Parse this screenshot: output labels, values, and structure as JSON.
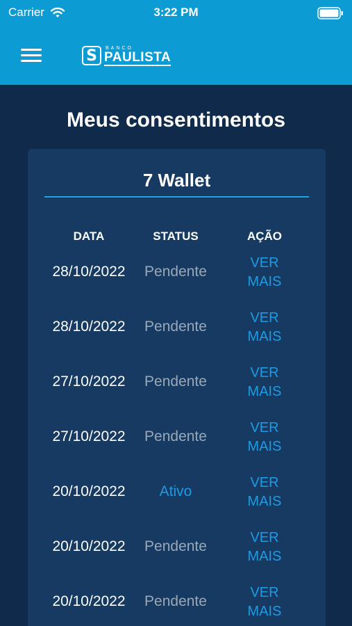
{
  "status_bar": {
    "carrier": "Carrier",
    "time": "3:22 PM"
  },
  "header": {
    "logo_small": "BANCO",
    "logo_big": "PAULISTA",
    "logo_mark": "S",
    "brand_color": "#0d9bd3"
  },
  "page": {
    "title": "Meus consentimentos"
  },
  "card": {
    "title": "7 Wallet",
    "columns": [
      "DATA",
      "STATUS",
      "AÇÃO"
    ],
    "rows": [
      {
        "date": "28/10/2022",
        "status": "Pendente",
        "action_line1": "VER",
        "action_line2": "MAIS"
      },
      {
        "date": "28/10/2022",
        "status": "Pendente",
        "action_line1": "VER",
        "action_line2": "MAIS"
      },
      {
        "date": "27/10/2022",
        "status": "Pendente",
        "action_line1": "VER",
        "action_line2": "MAIS"
      },
      {
        "date": "27/10/2022",
        "status": "Pendente",
        "action_line1": "VER",
        "action_line2": "MAIS"
      },
      {
        "date": "20/10/2022",
        "status": "Ativo",
        "action_line1": "VER",
        "action_line2": "MAIS"
      },
      {
        "date": "20/10/2022",
        "status": "Pendente",
        "action_line1": "VER",
        "action_line2": "MAIS"
      },
      {
        "date": "20/10/2022",
        "status": "Pendente",
        "action_line1": "VER",
        "action_line2": "MAIS"
      }
    ]
  },
  "colors": {
    "background": "#0f2a4a",
    "card": "#163a62",
    "accent": "#1f9be4",
    "pending": "#9aa8b8"
  },
  "icons": {
    "menu": "hamburger-menu-icon",
    "wifi": "wifi-icon",
    "battery": "battery-icon"
  }
}
